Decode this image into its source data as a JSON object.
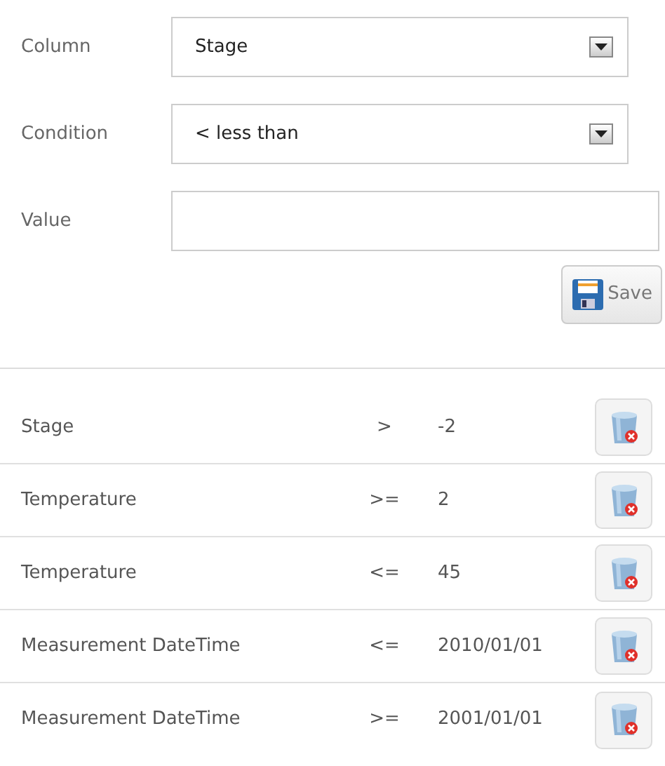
{
  "form": {
    "fields": [
      {
        "kind": "select",
        "label": "Column",
        "value": "Stage"
      },
      {
        "kind": "select",
        "label": "Condition",
        "value": "< less than"
      },
      {
        "kind": "text",
        "label": "Value"
      }
    ],
    "save_button": "Save"
  },
  "filters": [
    {
      "column": "Stage",
      "operator": ">",
      "value": "-2"
    },
    {
      "column": "Temperature",
      "operator": ">=",
      "value": "2"
    },
    {
      "column": "Temperature",
      "operator": "<=",
      "value": "45"
    },
    {
      "column": "Measurement DateTime",
      "operator": "<=",
      "value": "2010/01/01"
    },
    {
      "column": "Measurement DateTime",
      "operator": ">=",
      "value": "2001/01/01"
    }
  ]
}
